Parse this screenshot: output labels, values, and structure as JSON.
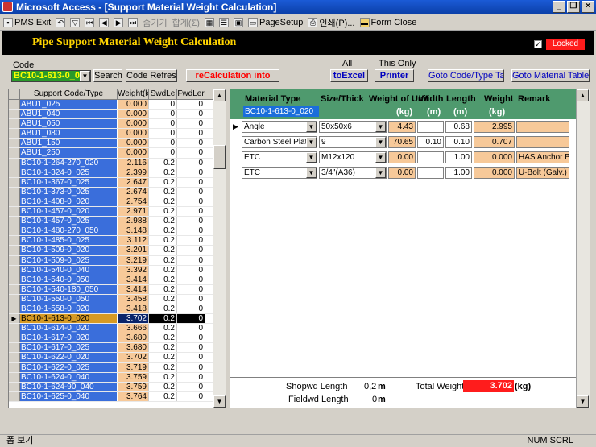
{
  "window": {
    "title": "Microsoft Access - [Support Material Weight Calculation]"
  },
  "menu": {
    "items": [
      "PMS Exit",
      "숨기기",
      "합계(Σ)",
      "PageSetup",
      "인쇄(P)...",
      "Form Close"
    ]
  },
  "header": {
    "title": "Pipe Support Material Weight Calculation",
    "locked_label": "Locked"
  },
  "controls": {
    "code_label": "Code",
    "code_value": "BC10-1-613-0_020",
    "search_label": "Search",
    "refresh_label": "Code Refresh",
    "recalc_label": "reCalculation into",
    "all_label": "All",
    "this_only_label": "This Only",
    "toexcel_label": "toExcel",
    "printer_label": "Printer",
    "goto_code_label": "Goto Code/Type Table",
    "goto_material_label": "Goto Material Table"
  },
  "left_grid": {
    "headers": [
      "Support Code/Type",
      "Weight(k",
      "SwdLe",
      "FwdLer"
    ],
    "rows": [
      {
        "code": "ABU1_025",
        "weight": "0.000",
        "swd": "0",
        "fwd": "0"
      },
      {
        "code": "ABU1_040",
        "weight": "0.000",
        "swd": "0",
        "fwd": "0"
      },
      {
        "code": "ABU1_050",
        "weight": "0.000",
        "swd": "0",
        "fwd": "0"
      },
      {
        "code": "ABU1_080",
        "weight": "0.000",
        "swd": "0",
        "fwd": "0"
      },
      {
        "code": "ABU1_150",
        "weight": "0.000",
        "swd": "0",
        "fwd": "0"
      },
      {
        "code": "ABU1_250",
        "weight": "0.000",
        "swd": "0",
        "fwd": "0"
      },
      {
        "code": "BC10-1-264-270_020",
        "weight": "2.116",
        "swd": "0.2",
        "fwd": "0"
      },
      {
        "code": "BC10-1-324-0_025",
        "weight": "2.399",
        "swd": "0.2",
        "fwd": "0"
      },
      {
        "code": "BC10-1-367-0_025",
        "weight": "2.647",
        "swd": "0.2",
        "fwd": "0"
      },
      {
        "code": "BC10-1-373-0_025",
        "weight": "2.674",
        "swd": "0.2",
        "fwd": "0"
      },
      {
        "code": "BC10-1-408-0_020",
        "weight": "2.754",
        "swd": "0.2",
        "fwd": "0"
      },
      {
        "code": "BC10-1-457-0_020",
        "weight": "2.971",
        "swd": "0.2",
        "fwd": "0"
      },
      {
        "code": "BC10-1-457-0_025",
        "weight": "2.988",
        "swd": "0.2",
        "fwd": "0"
      },
      {
        "code": "BC10-1-480-270_050",
        "weight": "3.148",
        "swd": "0.2",
        "fwd": "0"
      },
      {
        "code": "BC10-1-485-0_025",
        "weight": "3.112",
        "swd": "0.2",
        "fwd": "0"
      },
      {
        "code": "BC10-1-509-0_020",
        "weight": "3.201",
        "swd": "0.2",
        "fwd": "0"
      },
      {
        "code": "BC10-1-509-0_025",
        "weight": "3.219",
        "swd": "0.2",
        "fwd": "0"
      },
      {
        "code": "BC10-1-540-0_040",
        "weight": "3.392",
        "swd": "0.2",
        "fwd": "0"
      },
      {
        "code": "BC10-1-540-0_050",
        "weight": "3.414",
        "swd": "0.2",
        "fwd": "0"
      },
      {
        "code": "BC10-1-540-180_050",
        "weight": "3.414",
        "swd": "0.2",
        "fwd": "0"
      },
      {
        "code": "BC10-1-550-0_050",
        "weight": "3.458",
        "swd": "0.2",
        "fwd": "0"
      },
      {
        "code": "BC10-1-558-0_020",
        "weight": "3.418",
        "swd": "0.2",
        "fwd": "0"
      },
      {
        "code": "BC10-1-613-0_020",
        "weight": "3.702",
        "swd": "0.2",
        "fwd": "0",
        "current": true
      },
      {
        "code": "BC10-1-614-0_020",
        "weight": "3.666",
        "swd": "0.2",
        "fwd": "0"
      },
      {
        "code": "BC10-1-617-0_020",
        "weight": "3.680",
        "swd": "0.2",
        "fwd": "0"
      },
      {
        "code": "BC10-1-617-0_025",
        "weight": "3.680",
        "swd": "0.2",
        "fwd": "0"
      },
      {
        "code": "BC10-1-622-0_020",
        "weight": "3.702",
        "swd": "0.2",
        "fwd": "0"
      },
      {
        "code": "BC10-1-622-0_025",
        "weight": "3.719",
        "swd": "0.2",
        "fwd": "0"
      },
      {
        "code": "BC10-1-624-0_040",
        "weight": "3.759",
        "swd": "0.2",
        "fwd": "0"
      },
      {
        "code": "BC10-1-624-90_040",
        "weight": "3.759",
        "swd": "0.2",
        "fwd": "0"
      },
      {
        "code": "BC10-1-625-0_040",
        "weight": "3.764",
        "swd": "0.2",
        "fwd": "0"
      }
    ]
  },
  "detail": {
    "headers": {
      "material": "Material Type",
      "size": "Size/Thick",
      "wou": "Weight of Unit",
      "width": "Width",
      "length": "Length",
      "weight": "Weight",
      "remark": "Remark"
    },
    "units": {
      "wou": "(kg)",
      "width": "(m)",
      "length": "(m)",
      "weight": "(kg)"
    },
    "code": "BC10-1-613-0_020",
    "rows": [
      {
        "material": "Angle",
        "size": "50x50x6",
        "wou": "4.43",
        "width": "",
        "length": "0.68",
        "weight": "2.995",
        "remark": ""
      },
      {
        "material": "Carbon Steel Plate",
        "size": "9",
        "wou": "70.65",
        "width": "0.10",
        "length": "0.10",
        "weight": "0.707",
        "remark": ""
      },
      {
        "material": "ETC",
        "size": "M12x120",
        "wou": "0.00",
        "width": "",
        "length": "1.00",
        "weight": "0.000",
        "remark": "HAS Anchor Bol"
      },
      {
        "material": "ETC",
        "size": "3/4\"(A36)",
        "wou": "0.00",
        "width": "",
        "length": "1.00",
        "weight": "0.000",
        "remark": "U-Bolt (Galv.)"
      }
    ]
  },
  "footer": {
    "shopwd_label": "Shopwd Length",
    "shopwd_value": "0,2",
    "shopwd_unit": "m",
    "fieldwd_label": "Fieldwd Length",
    "fieldwd_value": "0",
    "fieldwd_unit": "m",
    "total_label": "Total Weight",
    "total_value": "3.702",
    "total_unit": "(kg)"
  },
  "status": {
    "left": "폼 보기",
    "right": "NUM  SCRL"
  }
}
